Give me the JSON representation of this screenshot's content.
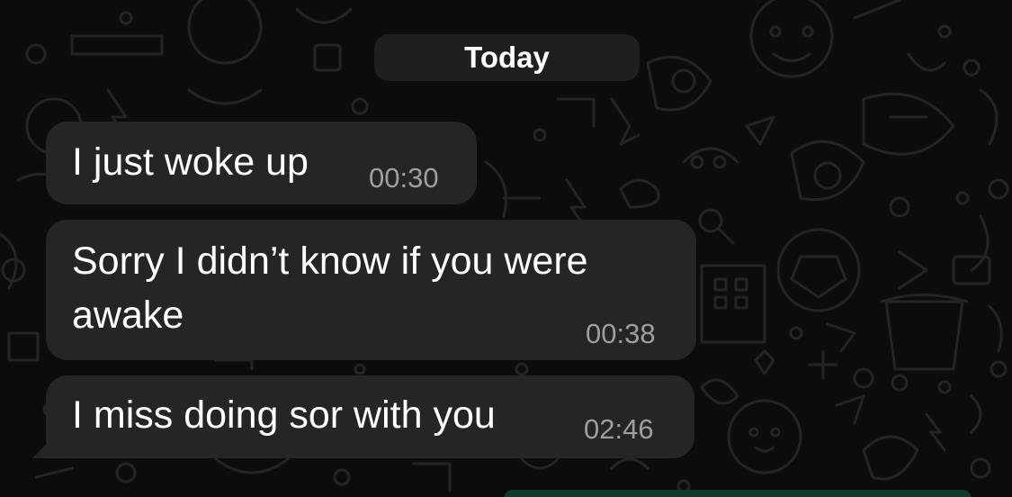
{
  "date_separator": "Today",
  "messages": [
    {
      "text": "I just woke up",
      "time": "00:30"
    },
    {
      "line1": "Sorry I didn’t know if you were",
      "line2": "awake",
      "time": "00:38"
    },
    {
      "text": "I miss doing sor with you",
      "time": "02:46"
    }
  ],
  "colors": {
    "background": "#0c0c0c",
    "incoming_bubble": "#252525",
    "date_pill": "#1f1f1f",
    "timestamp": "#9e9e9e",
    "outgoing_bubble_edge": "#0f3b2e"
  },
  "icons": [
    "doodle-wallpaper-pattern"
  ]
}
